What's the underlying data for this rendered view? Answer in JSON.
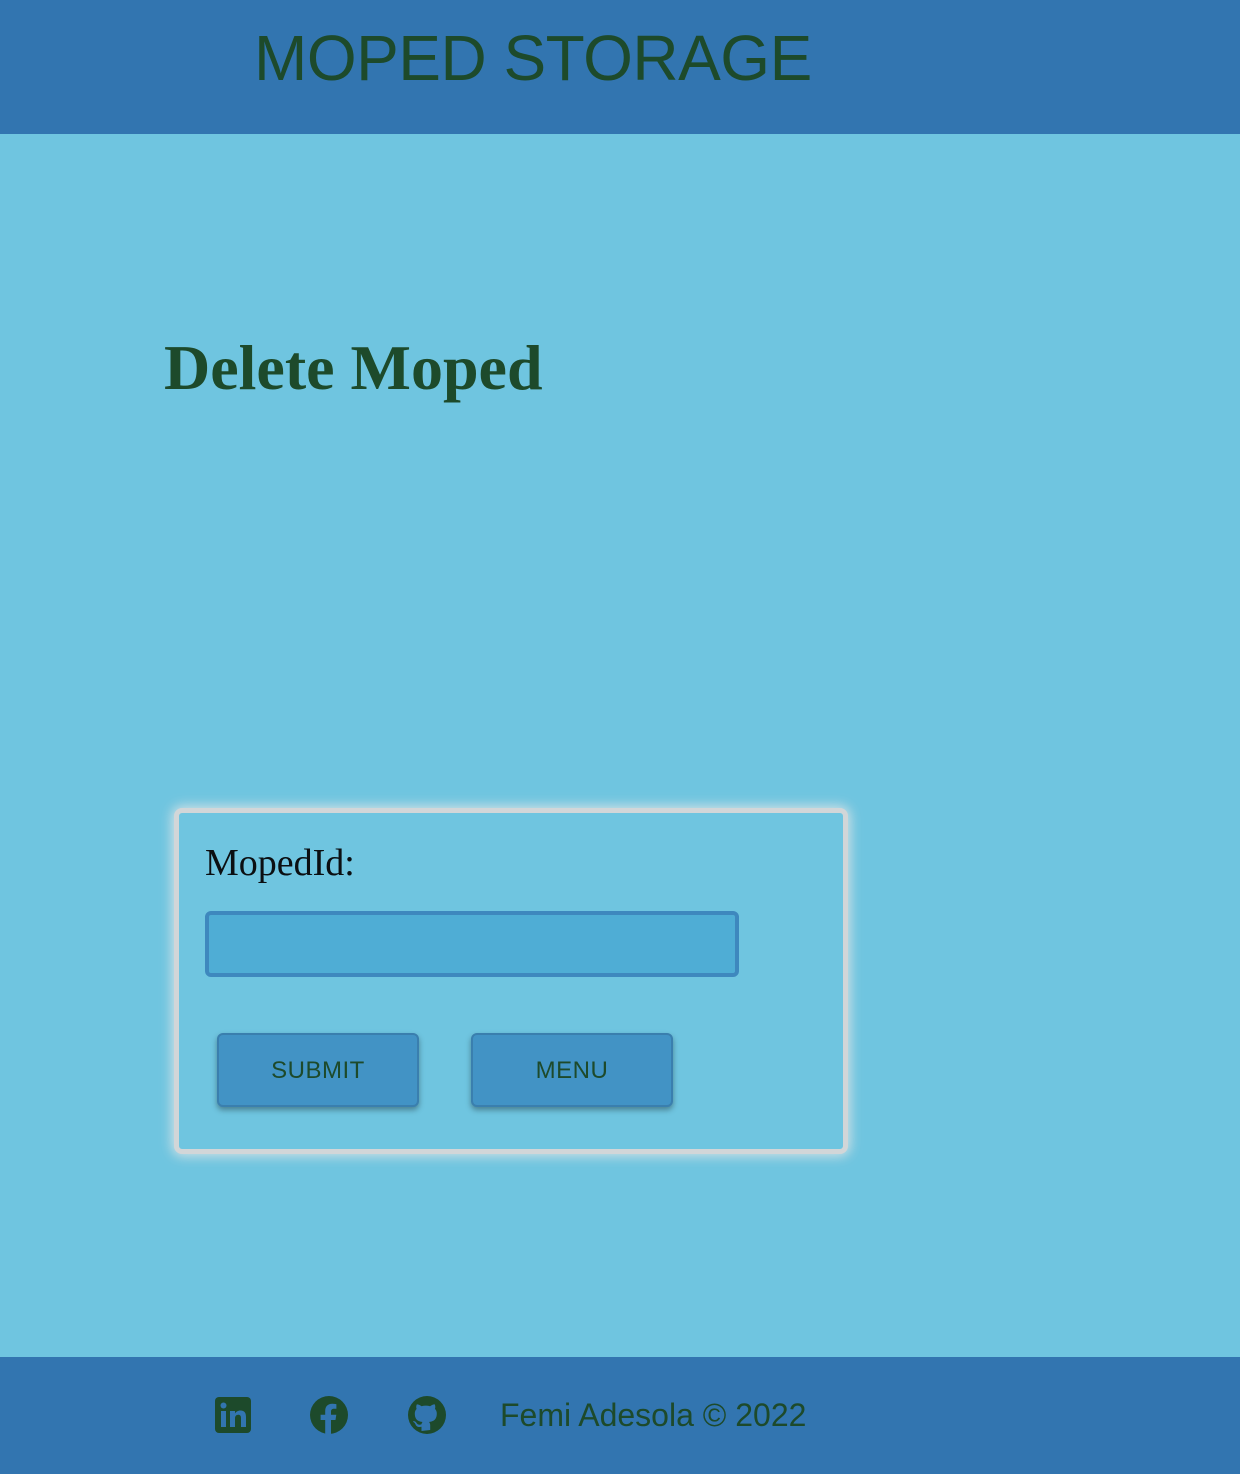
{
  "header": {
    "title": "MOPED STORAGE"
  },
  "main": {
    "page_title": "Delete Moped",
    "form": {
      "field_label": "MopedId:",
      "field_value": "",
      "submit_label": "SUBMIT",
      "menu_label": "MENU"
    }
  },
  "footer": {
    "social_icons": [
      "linkedin-icon",
      "facebook-icon",
      "github-icon"
    ],
    "credit": "Femi Adesola © 2022"
  },
  "colors": {
    "header_bg": "#3275b0",
    "page_bg": "#6fc5e0",
    "text_dark_green": "#1d4a2b",
    "input_bg": "#4fadd5",
    "button_bg": "#4293c5"
  }
}
